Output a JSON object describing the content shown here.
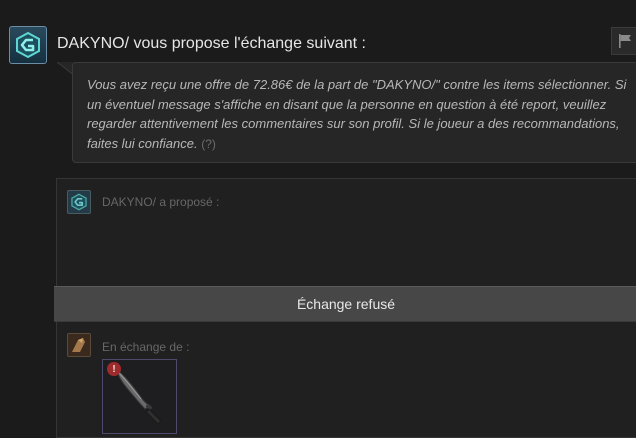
{
  "header": {
    "title": "DAKYNO/ vous propose l'échange suivant :"
  },
  "message": {
    "text": "Vous avez reçu une offre de 72.86€ de la part de \"DAKYNO/\" contre les items sélectionner. Si un éventuel message s'affiche en disant que la personne en question à été report, veuillez regarder attentivement les commentaires sur son profil. Si le joueur a des recommandations, faites lui confiance.",
    "help_label": "(?)"
  },
  "offer": {
    "proposed_label": "DAKYNO/ a proposé :",
    "status": "Échange refusé",
    "exchange_label": "En échange de :",
    "item_badge": "!"
  },
  "icons": {
    "avatar": "steam-avatar-icon",
    "flag": "flag-icon",
    "item": "knife-item-icon"
  },
  "colors": {
    "background": "#1b1b1b",
    "status_bar": "#474747",
    "item_border": "#4e4a6e",
    "warning_badge": "#9e2b2b"
  }
}
